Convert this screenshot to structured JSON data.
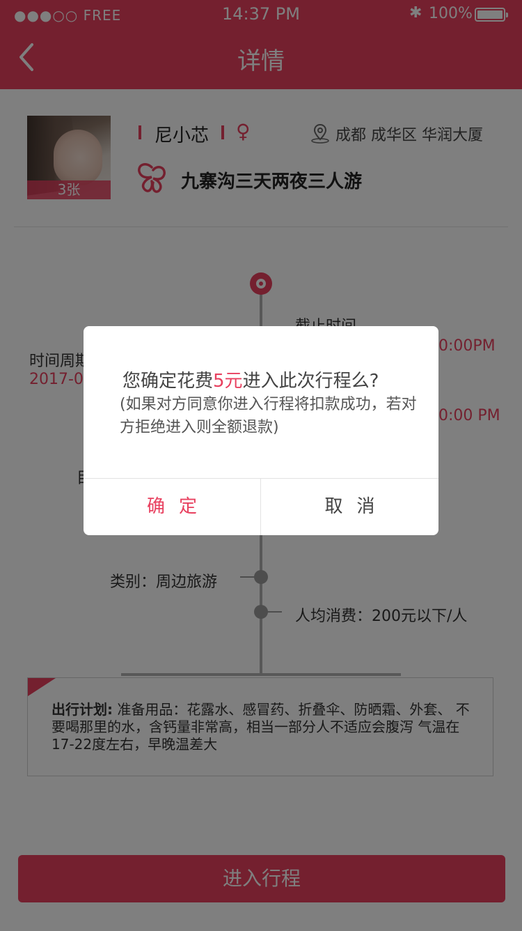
{
  "status_bar": {
    "signal": "●●●○○ FREE",
    "time": "14:37 PM",
    "bluetooth": "✱",
    "battery": "100%"
  },
  "nav": {
    "title": "详情"
  },
  "profile": {
    "photo_count": "3张",
    "name": "尼小芯",
    "gender": "♀",
    "location": "成都 成华区 华润大厦",
    "trip_title": "九寨沟三天两夜三人游"
  },
  "timeline": {
    "deadline_label": "截止时间",
    "time_period_label": "时间周期",
    "date_start": "2017-0",
    "time_top": "0:00PM",
    "time_bottom": "0:00 PM",
    "partial_left": "目",
    "category": "类别：周边旅游",
    "avg_cost": "人均消费：200元以下/人"
  },
  "plan": {
    "label": "出行计划:",
    "text": " 准备用品：花露水、感冒药、折叠伞、防晒霜、外套、 不要喝那里的水，含钙量非常高，相当一部分人不适应会腹泻 气温在17-22度左右，早晚温差大"
  },
  "enter_button": "进入行程",
  "dialog": {
    "q_prefix": "您确定花费",
    "q_amount": "5元",
    "q_suffix": "进入此次行程么?",
    "note": "(如果对方同意你进入行程将扣款成功，若对方拒绝进入则全额退款)",
    "confirm": "确定",
    "cancel": "取消"
  }
}
